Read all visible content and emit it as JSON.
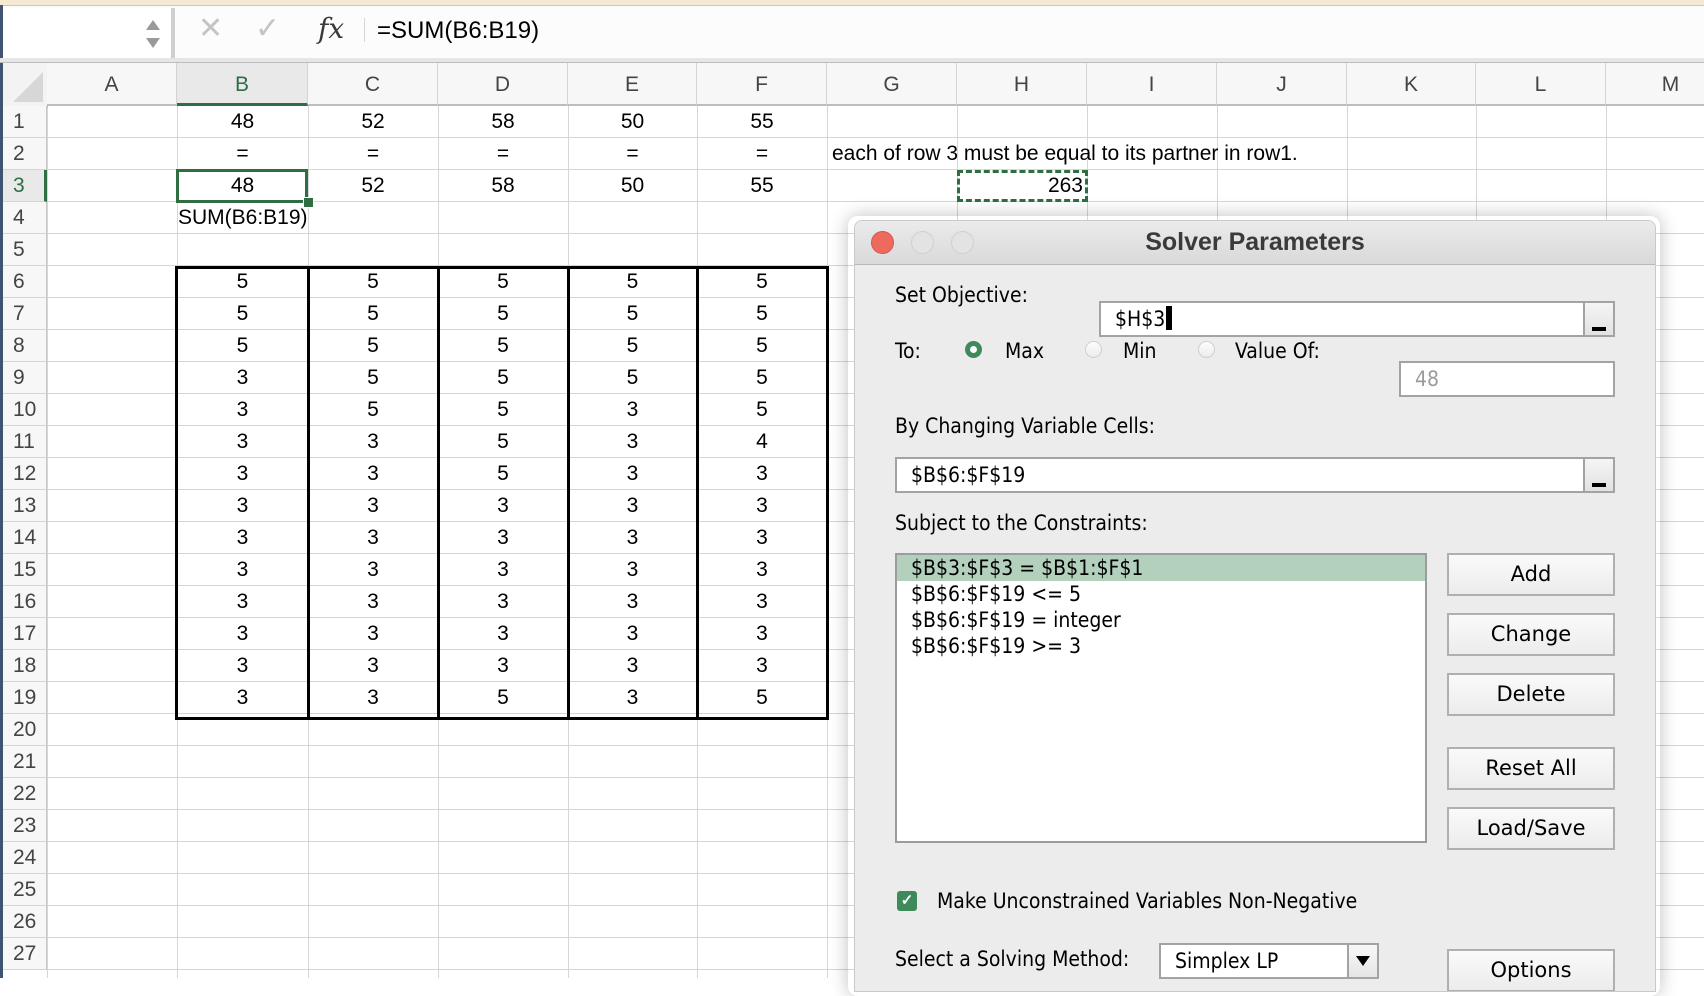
{
  "formula_bar": {
    "name_box": "",
    "cancel_icon": "x-icon",
    "enter_icon": "checkmark-icon",
    "function_icon": "fx",
    "formula": "=SUM(B6:B19)"
  },
  "sheet": {
    "columns": [
      "A",
      "B",
      "C",
      "D",
      "E",
      "F",
      "G",
      "H",
      "I",
      "J",
      "K",
      "L",
      "M"
    ],
    "selected_column": "B",
    "selected_row": 3,
    "selected_cell": "B3",
    "copy_marquee_cell": "H3",
    "rows": [
      1,
      2,
      3,
      4,
      5,
      6,
      7,
      8,
      9,
      10,
      11,
      12,
      13,
      14,
      15,
      16,
      17,
      18,
      19,
      20,
      21,
      22,
      23,
      24,
      25,
      26,
      27
    ],
    "row1": [
      "48",
      "52",
      "58",
      "50",
      "55"
    ],
    "row2": [
      "=",
      "=",
      "=",
      "=",
      "="
    ],
    "row2_note": "each of row 3 must be equal to its partner in row1.",
    "row3": [
      "48",
      "52",
      "58",
      "50",
      "55"
    ],
    "h3": "263",
    "b4": "SUM(B6:B19)",
    "table": [
      [
        "5",
        "5",
        "5",
        "5",
        "5"
      ],
      [
        "5",
        "5",
        "5",
        "5",
        "5"
      ],
      [
        "5",
        "5",
        "5",
        "5",
        "5"
      ],
      [
        "3",
        "5",
        "5",
        "5",
        "5"
      ],
      [
        "3",
        "5",
        "5",
        "3",
        "5"
      ],
      [
        "3",
        "3",
        "5",
        "3",
        "4"
      ],
      [
        "3",
        "3",
        "5",
        "3",
        "3"
      ],
      [
        "3",
        "3",
        "3",
        "3",
        "3"
      ],
      [
        "3",
        "3",
        "3",
        "3",
        "3"
      ],
      [
        "3",
        "3",
        "3",
        "3",
        "3"
      ],
      [
        "3",
        "3",
        "3",
        "3",
        "3"
      ],
      [
        "3",
        "3",
        "3",
        "3",
        "3"
      ],
      [
        "3",
        "3",
        "3",
        "3",
        "3"
      ],
      [
        "3",
        "3",
        "5",
        "3",
        "5"
      ]
    ]
  },
  "dialog": {
    "title": "Solver Parameters",
    "set_objective_label": "Set Objective:",
    "set_objective_value": "$H$3",
    "to_label": "To:",
    "options": [
      {
        "label": "Max",
        "selected": true
      },
      {
        "label": "Min",
        "selected": false
      },
      {
        "label": "Value Of:",
        "selected": false
      }
    ],
    "value_of_value": "48",
    "changing_label": "By Changing Variable Cells:",
    "changing_value": "$B$6:$F$19",
    "constraints_label": "Subject to the Constraints:",
    "constraints": [
      "$B$3:$F$3 = $B$1:$F$1",
      "$B$6:$F$19 <= 5",
      "$B$6:$F$19 = integer",
      "$B$6:$F$19 >= 3"
    ],
    "selected_constraint": 0,
    "buttons": {
      "add": "Add",
      "change": "Change",
      "delete": "Delete",
      "reset_all": "Reset All",
      "load_save": "Load/Save",
      "options": "Options"
    },
    "nonneg_label": "Make Unconstrained Variables Non-Negative",
    "nonneg_checked": true,
    "method_label": "Select a Solving Method:",
    "method_value": "Simplex LP",
    "colors": {
      "accent": "#3f8a5b",
      "close": "#ee6a5f",
      "selection": "#b2d0bb"
    }
  }
}
